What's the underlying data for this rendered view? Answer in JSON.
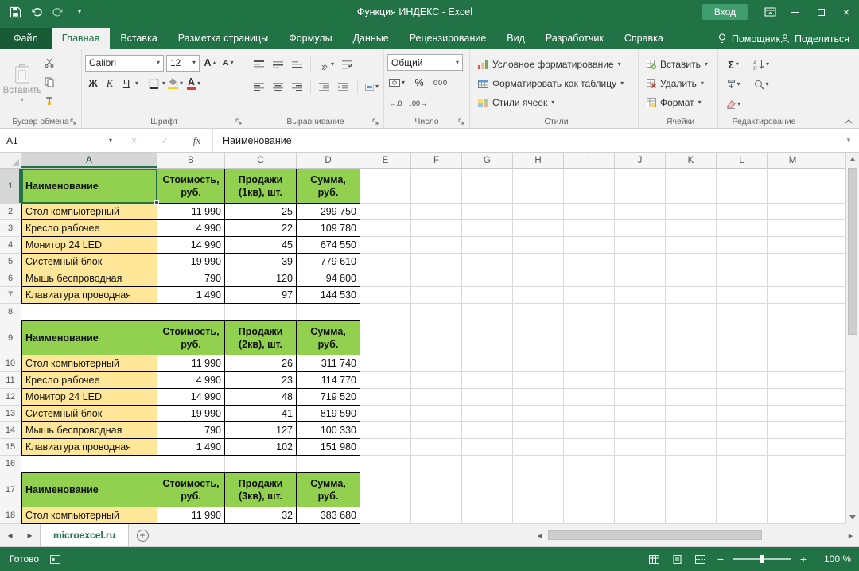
{
  "colors": {
    "green": "#217346",
    "green-dark": "#185c37",
    "signin": "#3f9d6e",
    "table-header": "#92d050",
    "name-column": "#ffe699"
  },
  "icons": {
    "caret_down": "▾",
    "caret_up": "▴",
    "check": "✓",
    "close": "×",
    "sigma": "Σ",
    "letter_a": "А",
    "letter_ya": "Я",
    "orientation_ab": "ab",
    "minus": "−",
    "plus": "+",
    "nav_left": "◂",
    "nav_right": "▸"
  },
  "titlebar": {
    "title": "Функция ИНДЕКС - Excel",
    "signin": "Вход"
  },
  "tabs": {
    "items": [
      "Файл",
      "Главная",
      "Вставка",
      "Разметка страницы",
      "Формулы",
      "Данные",
      "Рецензирование",
      "Вид",
      "Разработчик",
      "Справка"
    ],
    "active": "Главная",
    "assistant": "Помощник",
    "share": "Поделиться"
  },
  "ribbon": {
    "clipboard": {
      "label": "Буфер обмена",
      "paste": "Вставить"
    },
    "font": {
      "label": "Шрифт",
      "name": "Calibri",
      "size": "12",
      "bold": "Ж",
      "italic": "К",
      "underline": "Ч"
    },
    "alignment": {
      "label": "Выравнивание"
    },
    "number": {
      "label": "Число",
      "format": "Общий",
      "percent": "%",
      "thousands": "000",
      "dec_inc": "←.0",
      "dec_dec": ".00→"
    },
    "styles": {
      "label": "Стили",
      "conditional": "Условное форматирование",
      "format_table": "Форматировать как таблицу",
      "cell_styles": "Стили ячеек"
    },
    "cells": {
      "label": "Ячейки",
      "insert": "Вставить",
      "delete": "Удалить",
      "format": "Формат"
    },
    "editing": {
      "label": "Редактирование"
    }
  },
  "formula_bar": {
    "name_box": "A1",
    "fx": "fx",
    "content": "Наименование"
  },
  "grid": {
    "columns": [
      "A",
      "B",
      "C",
      "D",
      "E",
      "F",
      "G",
      "H",
      "I",
      "J",
      "K",
      "L",
      "M"
    ],
    "rows": 18,
    "selected_cell": "A1",
    "tables": [
      {
        "header_row": 1,
        "header": [
          "Наименование",
          "Стоимость,\nруб.",
          "Продажи\n(1кв), шт.",
          "Сумма,\nруб."
        ],
        "data": [
          [
            "Стол компьютерный",
            "11 990",
            "25",
            "299 750"
          ],
          [
            "Кресло рабочее",
            "4 990",
            "22",
            "109 780"
          ],
          [
            "Монитор 24 LED",
            "14 990",
            "45",
            "674 550"
          ],
          [
            "Системный блок",
            "19 990",
            "39",
            "779 610"
          ],
          [
            "Мышь беспроводная",
            "790",
            "120",
            "94 800"
          ],
          [
            "Клавиатура проводная",
            "1 490",
            "97",
            "144 530"
          ]
        ]
      },
      {
        "header_row": 9,
        "header": [
          "Наименование",
          "Стоимость,\nруб.",
          "Продажи\n(2кв), шт.",
          "Сумма,\nруб."
        ],
        "data": [
          [
            "Стол компьютерный",
            "11 990",
            "26",
            "311 740"
          ],
          [
            "Кресло рабочее",
            "4 990",
            "23",
            "114 770"
          ],
          [
            "Монитор 24 LED",
            "14 990",
            "48",
            "719 520"
          ],
          [
            "Системный блок",
            "19 990",
            "41",
            "819 590"
          ],
          [
            "Мышь беспроводная",
            "790",
            "127",
            "100 330"
          ],
          [
            "Клавиатура проводная",
            "1 490",
            "102",
            "151 980"
          ]
        ]
      },
      {
        "header_row": 17,
        "header": [
          "Наименование",
          "Стоимость,\nруб.",
          "Продажи\n(3кв), шт.",
          "Сумма,\nруб."
        ],
        "data": [
          [
            "Стол компьютерный",
            "11 990",
            "32",
            "383 680"
          ]
        ]
      }
    ]
  },
  "sheet_bar": {
    "tab": "microexcel.ru"
  },
  "status_bar": {
    "status": "Готово",
    "zoom": "100 %"
  }
}
